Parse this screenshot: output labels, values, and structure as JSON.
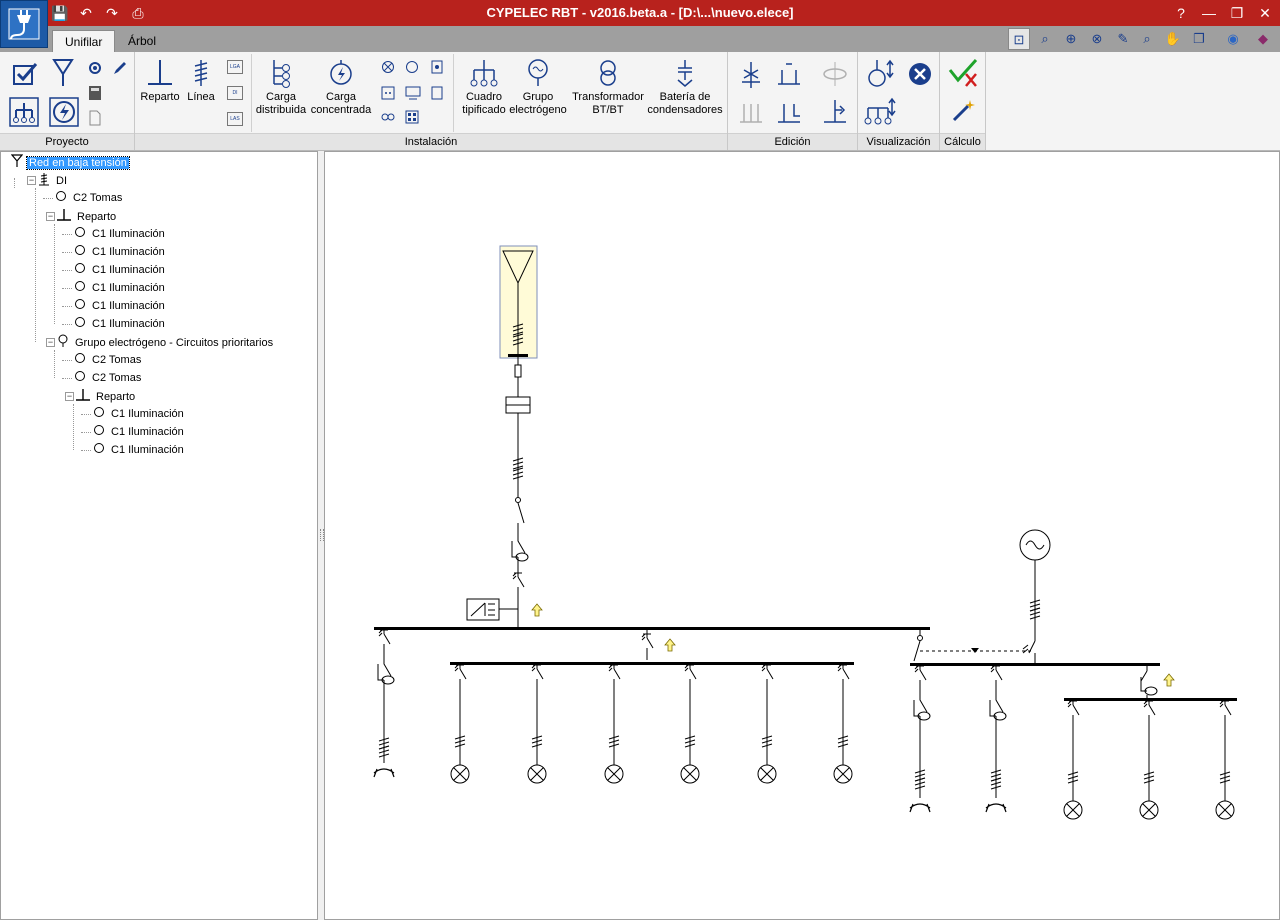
{
  "window": {
    "title": "CYPELEC RBT - v2016.beta.a - [D:\\...\\nuevo.elece]",
    "help": "?",
    "minimize": "—",
    "restore": "❐",
    "close": "✕"
  },
  "qat": {
    "save": "💾",
    "undo": "↶",
    "redo": "↷",
    "print": "⎙"
  },
  "tabs": [
    {
      "label": "Unifilar"
    },
    {
      "label": "Árbol"
    }
  ],
  "ribbon": {
    "groups": {
      "proyecto": "Proyecto",
      "instalacion": "Instalación",
      "edicion": "Edición",
      "visualizacion": "Visualización",
      "calculo": "Cálculo"
    },
    "buttons": {
      "reparto": "Reparto",
      "linea": "Línea",
      "carga_distribuida": [
        "Carga",
        "distribuida"
      ],
      "carga_concentrada": [
        "Carga",
        "concentrada"
      ],
      "cuadro_tipificado": [
        "Cuadro",
        "tipificado"
      ],
      "grupo_electrogeno": [
        "Grupo",
        "electrógeno"
      ],
      "transformador": [
        "Transformador",
        "BT/BT"
      ],
      "bateria": [
        "Batería de",
        "condensadores"
      ]
    },
    "small_labels": {
      "lga": "LGA",
      "di": "DI",
      "las": "LAS"
    }
  },
  "tree": [
    {
      "label": "Red en baja tensión",
      "level": 0,
      "icon": "antenna-icon",
      "selected": true
    },
    {
      "label": "DI",
      "level": 1,
      "icon": "line-icon"
    },
    {
      "label": "C2 Tomas",
      "level": 2,
      "icon": "circuit-icon"
    },
    {
      "label": "Reparto",
      "level": 2,
      "icon": "reparto-icon"
    },
    {
      "label": "C1 Iluminación",
      "level": 3,
      "icon": "circuit-icon"
    },
    {
      "label": "C1 Iluminación",
      "level": 3,
      "icon": "circuit-icon"
    },
    {
      "label": "C1 Iluminación",
      "level": 3,
      "icon": "circuit-icon"
    },
    {
      "label": "C1 Iluminación",
      "level": 3,
      "icon": "circuit-icon"
    },
    {
      "label": "C1 Iluminación",
      "level": 3,
      "icon": "circuit-icon"
    },
    {
      "label": "C1 Iluminación",
      "level": 3,
      "icon": "circuit-icon"
    },
    {
      "label": "Grupo electrógeno - Circuitos prioritarios",
      "level": 2,
      "icon": "generator-icon"
    },
    {
      "label": "C2 Tomas",
      "level": 3,
      "icon": "circuit-icon"
    },
    {
      "label": "C2 Tomas",
      "level": 3,
      "icon": "circuit-icon"
    },
    {
      "label": "Reparto",
      "level": 3,
      "icon": "reparto-icon"
    },
    {
      "label": "C1 Iluminación",
      "level": 4,
      "icon": "circuit-icon"
    },
    {
      "label": "C1 Iluminación",
      "level": 4,
      "icon": "circuit-icon"
    },
    {
      "label": "C1 Iluminación",
      "level": 4,
      "icon": "circuit-icon"
    }
  ],
  "colors": {
    "titlebar": "#b8221d",
    "app_button": "#1d5aa6",
    "selection": "#3399ff",
    "icon_blue": "#1a3e8c"
  }
}
